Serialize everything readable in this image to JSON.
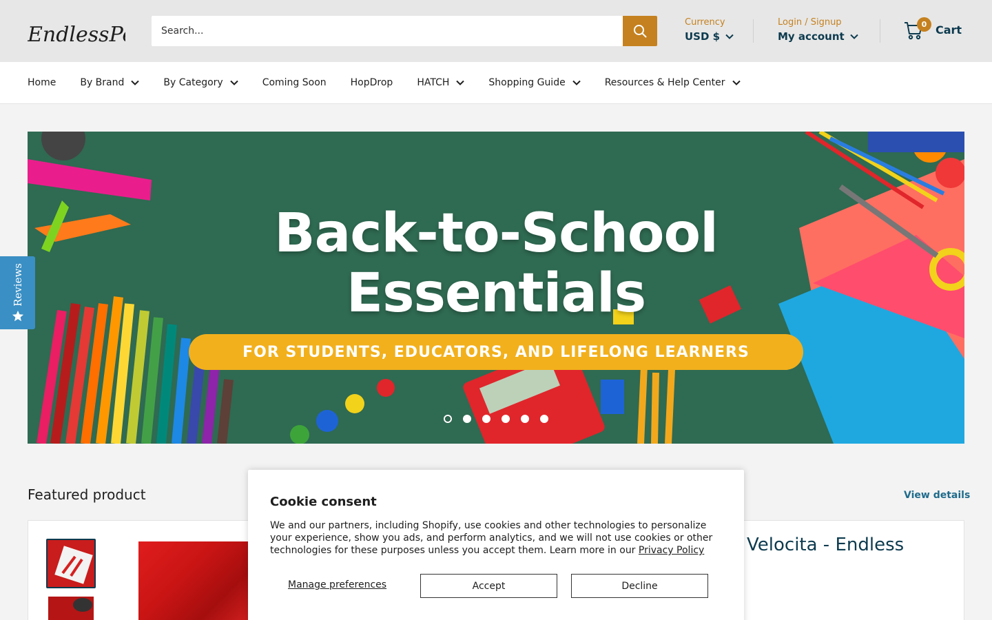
{
  "header": {
    "logo_text": "EndlessPens",
    "search": {
      "placeholder": "Search..."
    },
    "currency": {
      "label": "Currency",
      "value": "USD $"
    },
    "account": {
      "label": "Login / Signup",
      "value": "My account"
    },
    "cart": {
      "count": "0",
      "label": "Cart"
    }
  },
  "nav": {
    "items": [
      {
        "label": "Home"
      },
      {
        "label": "By Brand"
      },
      {
        "label": "By Category"
      },
      {
        "label": "Coming Soon"
      },
      {
        "label": "HopDrop"
      },
      {
        "label": "HATCH"
      },
      {
        "label": "Shopping Guide"
      },
      {
        "label": "Resources & Help Center"
      }
    ]
  },
  "banner": {
    "title_line1": "Back-to-School",
    "title_line2": "Essentials",
    "subtitle": "FOR STUDENTS, EDUCATORS, AND LIFELONG LEARNERS",
    "slide_count": 6,
    "active_slide": 1
  },
  "reviews_tab": {
    "label": "Reviews"
  },
  "featured": {
    "title": "Featured product",
    "view_details": "View details",
    "product_title": "Velocita - Endless"
  },
  "cookie": {
    "title": "Cookie consent",
    "body": "We and our partners, including Shopify, use cookies and other technologies to personalize your experience, show you ads, and perform analytics, and we will not use cookies or other technologies for these purposes unless you accept them. Learn more in our ",
    "privacy_link": "Privacy Policy",
    "manage": "Manage preferences",
    "accept": "Accept",
    "decline": "Decline"
  },
  "colors": {
    "accent": "#c5811f",
    "brand_dark": "#0d3b4f",
    "banner_green": "#2f6a52",
    "banner_pill": "#f2b01c",
    "reviews_blue": "#3a8fc4"
  }
}
